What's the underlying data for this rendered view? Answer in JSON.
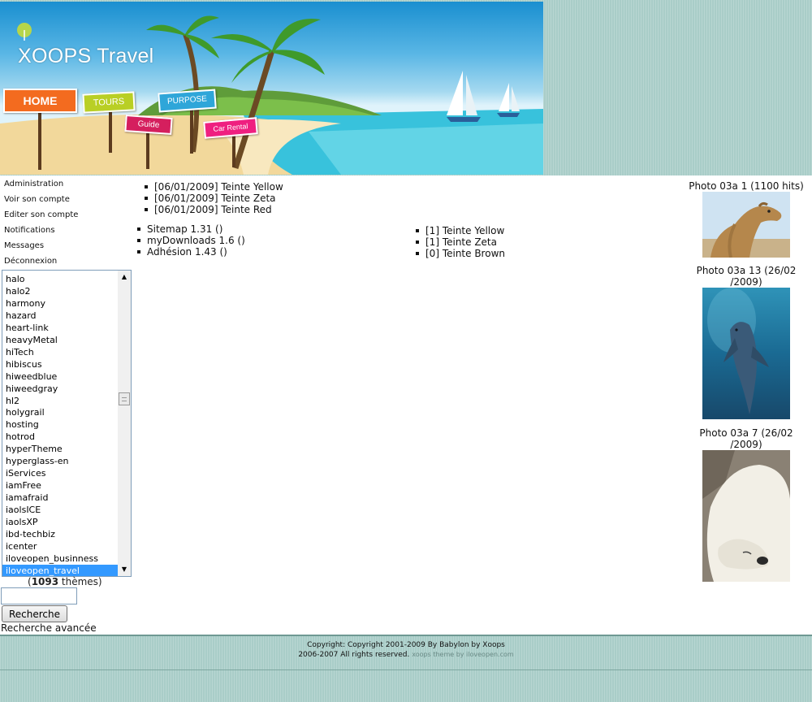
{
  "header": {
    "site_title": "XOOPS Travel",
    "nav": {
      "home": "HOME",
      "tours": "TOURS",
      "purpose": "PURPOSE",
      "guide": "Guide",
      "car_rental": "Car Rental"
    }
  },
  "user_menu": [
    "Administration",
    "Voir son compte",
    "Editer son compte",
    "Notifications",
    "Messages",
    "Déconnexion"
  ],
  "theme_selector": {
    "options": [
      "halo",
      "halo2",
      "harmony",
      "hazard",
      "heart-link",
      "heavyMetal",
      "hiTech",
      "hibiscus",
      "hiweedblue",
      "hiweedgray",
      "hl2",
      "holygrail",
      "hosting",
      "hotrod",
      "hyperTheme",
      "hyperglass-en",
      "iServices",
      "iamFree",
      "iamafraid",
      "iaolsICE",
      "iaolsXP",
      "ibd-techbiz",
      "icenter",
      "iloveopen_businness",
      "iloveopen_travel"
    ],
    "selected": "iloveopen_travel",
    "count_open": "(",
    "count": "1093",
    "count_label": " thèmes)"
  },
  "search": {
    "value": "",
    "button_label": "Recherche",
    "advanced_label": "Recherche avancée"
  },
  "news": [
    "[06/01/2009] Teinte Yellow",
    "[06/01/2009] Teinte Zeta",
    "[06/01/2009] Teinte Red"
  ],
  "modules": [
    "Sitemap 1.31 ()",
    "myDownloads 1.6 ()",
    "Adhésion 1.43 ()"
  ],
  "downloads": [
    "[1] Teinte Yellow",
    "[1] Teinte Zeta",
    "[0] Teinte Brown"
  ],
  "photos": [
    {
      "caption_line1": "Photo 03a 1 (1100 hits)",
      "caption_line2": "",
      "subject": "camel"
    },
    {
      "caption_line1": "Photo 03a 13 (26/02",
      "caption_line2": "/2009)",
      "subject": "dolphin"
    },
    {
      "caption_line1": "Photo 03a 7 (26/02",
      "caption_line2": "/2009)",
      "subject": "polar-bear"
    }
  ],
  "footer": {
    "line1": "Copyright: Copyright 2001-2009 By Babylon by Xoops",
    "line2": "2006-2007 All rights reserved.",
    "theme_credit": "xoops theme by iloveopen.com"
  }
}
